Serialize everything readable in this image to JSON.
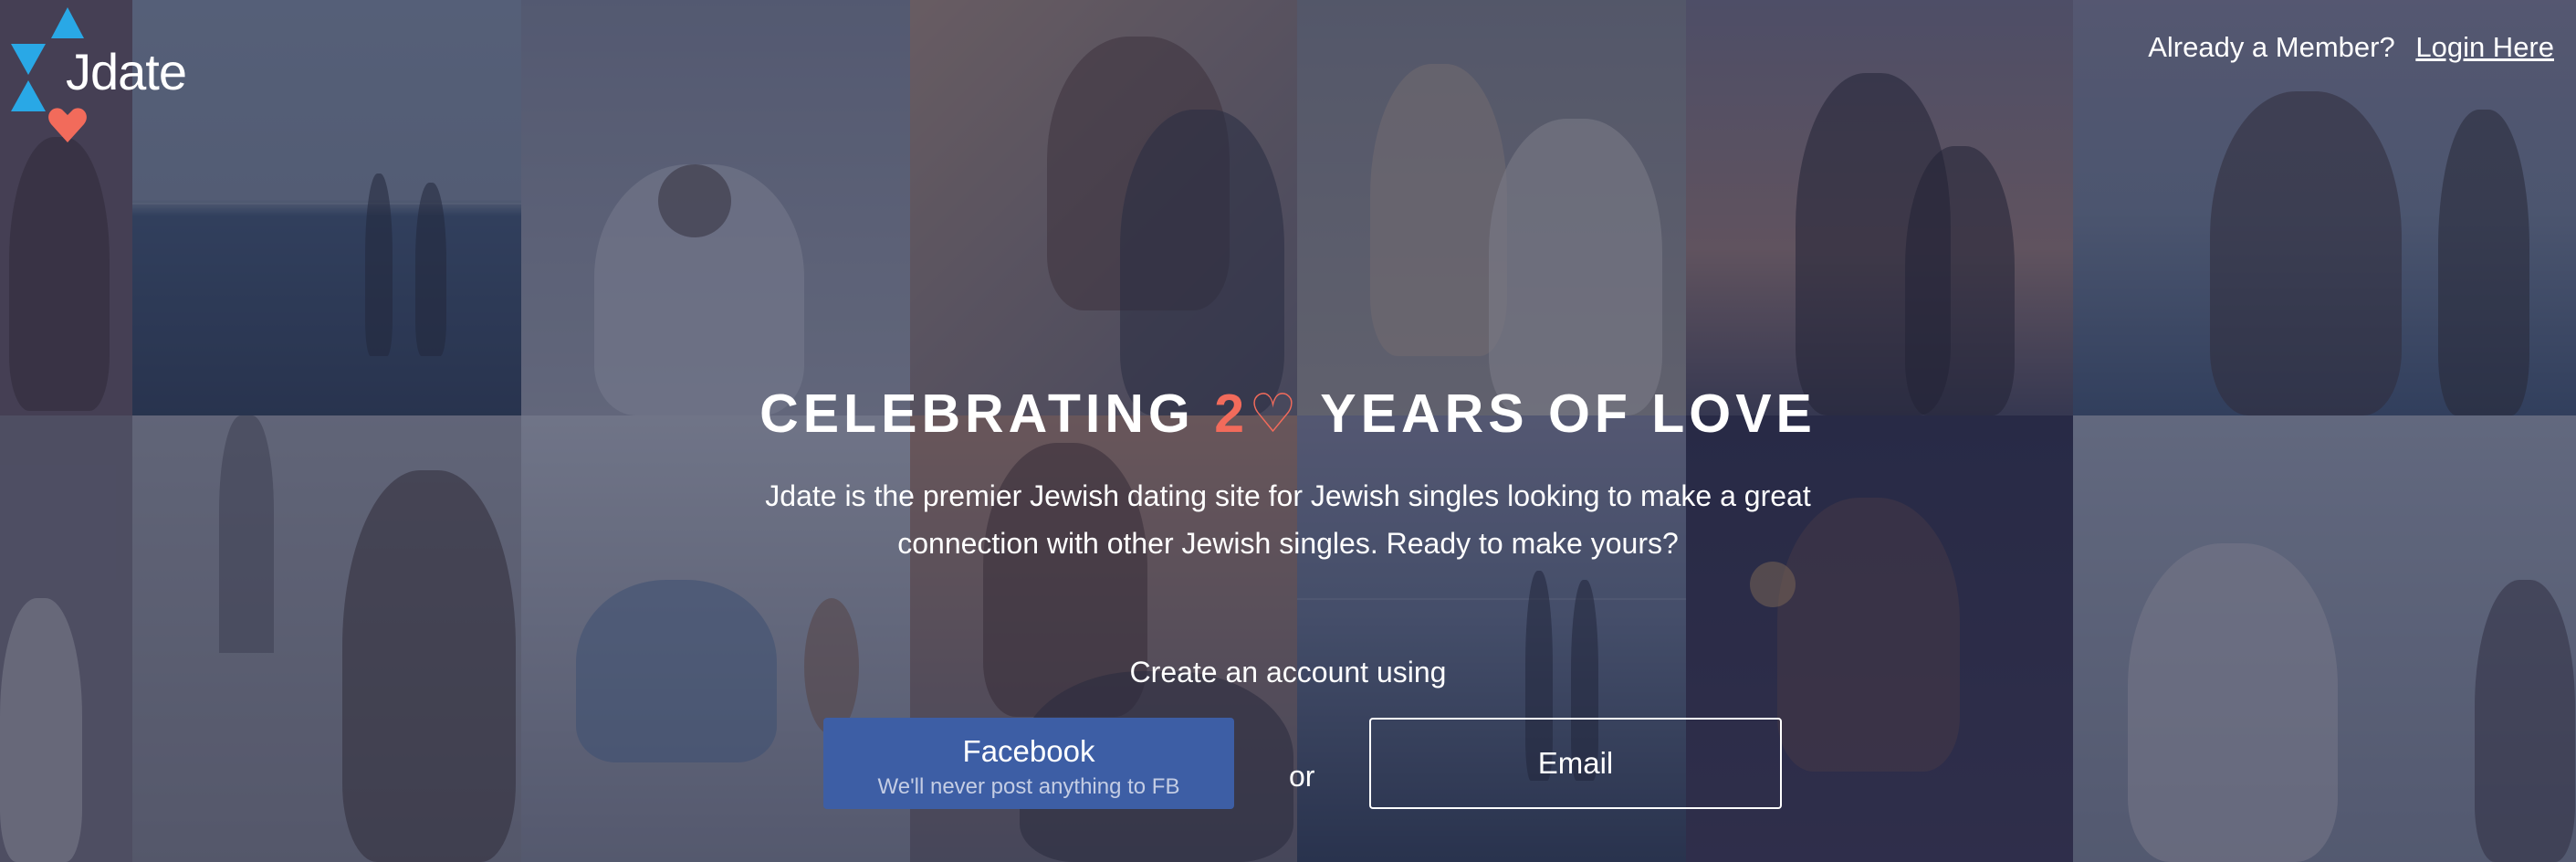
{
  "brand": {
    "name": "Jdate",
    "colors": {
      "triangle": "#29a8e6",
      "heart": "#f26b5b",
      "facebook": "#3d5ea5"
    }
  },
  "header": {
    "member_prompt": "Already a Member?",
    "login_label": "Login Here"
  },
  "hero": {
    "headline_pre": "CELEBRATING ",
    "headline_num": "2",
    "headline_heart": "♡",
    "headline_post": " YEARS OF LOVE",
    "description": "Jdate is the premier Jewish dating site for Jewish singles looking to make a great connection with other Jewish singles. Ready to make yours?"
  },
  "signup": {
    "prompt": "Create an account using",
    "facebook_label": "Facebook",
    "facebook_note": "We'll never post anything to FB",
    "or_label": "or",
    "email_label": "Email"
  },
  "icons": {
    "logo": "jdate-star-heart-logo"
  }
}
